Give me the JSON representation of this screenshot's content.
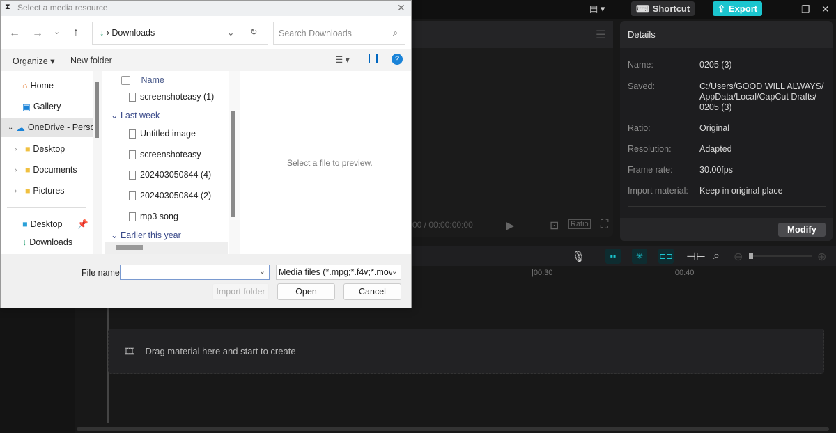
{
  "app": {
    "shortcut_label": "Shortcut",
    "export_label": "Export"
  },
  "player": {
    "timecode": "00 / 00:00:00:00",
    "ratio_label": "Ratio"
  },
  "details": {
    "title": "Details",
    "rows": [
      {
        "label": "Name:",
        "value": "0205 (3)"
      },
      {
        "label": "Saved:",
        "value": "C:/Users/GOOD WILL ALWAYS/ AppData/Local/CapCut Drafts/ 0205 (3)"
      },
      {
        "label": "Ratio:",
        "value": "Original"
      },
      {
        "label": "Resolution:",
        "value": "Adapted"
      },
      {
        "label": "Frame rate:",
        "value": "30.00fps"
      },
      {
        "label": "Import material:",
        "value": "Keep in original place"
      }
    ],
    "modify_label": "Modify"
  },
  "timeline": {
    "ruler": [
      "|00:30",
      "|00:40"
    ],
    "drop_text": "Drag material here and start to create"
  },
  "dialog": {
    "title": "Select a media resource",
    "address": "Downloads",
    "search_placeholder": "Search Downloads",
    "organize_label": "Organize",
    "new_folder_label": "New folder",
    "nav": [
      "Home",
      "Gallery",
      "OneDrive - Perso",
      "Desktop",
      "Documents",
      "Pictures",
      "Desktop",
      "Downloads"
    ],
    "column_name": "Name",
    "groups": [
      "Last week",
      "Earlier this year"
    ],
    "files": [
      "screenshoteasy (1)",
      "Untitled image",
      "screenshoteasy",
      "202403050844 (4)",
      "202403050844 (2)",
      "mp3 song"
    ],
    "preview_text": "Select a file to preview.",
    "file_name_label": "File name:",
    "file_name_value": "",
    "file_type": "Media files (*.mpg;*.f4v;*.mov;*",
    "import_folder_label": "Import folder",
    "open_label": "Open",
    "cancel_label": "Cancel"
  }
}
